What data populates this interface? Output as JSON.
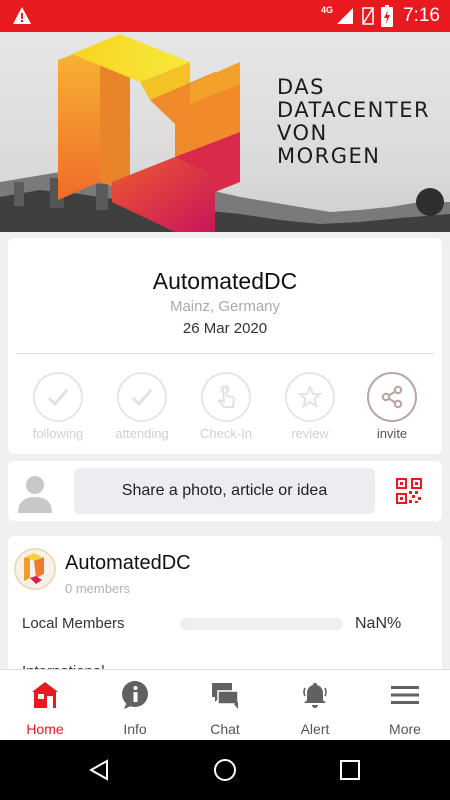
{
  "status_bar": {
    "time": "7:16",
    "network": "4G",
    "warning_icon": "warning-icon",
    "accent": "#e8191f"
  },
  "banner": {
    "lines": [
      "DAS",
      "DATACENTER",
      "VON",
      "MORGEN"
    ]
  },
  "event": {
    "title": "AutomatedDC",
    "location": "Mainz, Germany",
    "date": "26 Mar 2020",
    "actions": [
      {
        "label": "following",
        "icon": "check-icon",
        "active": false
      },
      {
        "label": "attending",
        "icon": "check-icon",
        "active": false
      },
      {
        "label": "Check-In",
        "icon": "tap-hand-icon",
        "active": false
      },
      {
        "label": "review",
        "icon": "star-icon",
        "active": false
      },
      {
        "label": "invite",
        "icon": "share-icon",
        "active": true
      }
    ]
  },
  "share": {
    "prompt": "Share a photo, article or idea",
    "qr_icon": "qr-code-icon"
  },
  "group": {
    "name": "AutomatedDC",
    "members": "0 members",
    "local_label": "Local Members",
    "local_value": "NaN%",
    "local_fill_fraction": 0,
    "next_label": "International"
  },
  "nav": {
    "items": [
      {
        "label": "Home",
        "icon": "home-icon",
        "active": true
      },
      {
        "label": "Info",
        "icon": "info-icon",
        "active": false
      },
      {
        "label": "Chat",
        "icon": "chat-icon",
        "active": false
      },
      {
        "label": "Alert",
        "icon": "bell-icon",
        "active": false
      },
      {
        "label": "More",
        "icon": "menu-icon",
        "active": false
      }
    ]
  }
}
